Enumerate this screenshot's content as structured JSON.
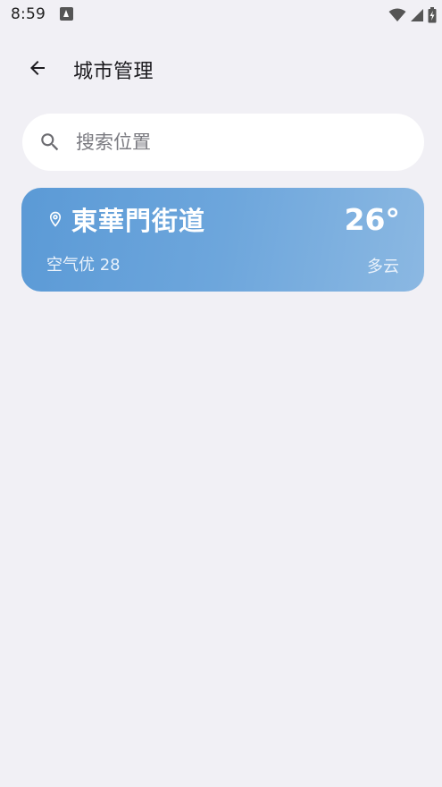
{
  "status_bar": {
    "time": "8:59",
    "notification_icon": "a-icon",
    "wifi_icon": "wifi-icon",
    "signal_icon": "cell-signal-icon",
    "battery_icon": "battery-charging-icon"
  },
  "app_bar": {
    "back_icon": "arrow-back-icon",
    "title": "城市管理"
  },
  "search": {
    "icon": "search-icon",
    "placeholder": "搜索位置",
    "value": ""
  },
  "cities": [
    {
      "name": "東華門街道",
      "temperature": "26°",
      "air_quality": "空气优 28",
      "weather": "多云",
      "location_icon": "location-pin-icon",
      "gradient_start": "#5b9ad6",
      "gradient_end": "#8bb8e2"
    }
  ],
  "colors": {
    "background": "#f1f0f5",
    "search_background": "#ffffff"
  }
}
